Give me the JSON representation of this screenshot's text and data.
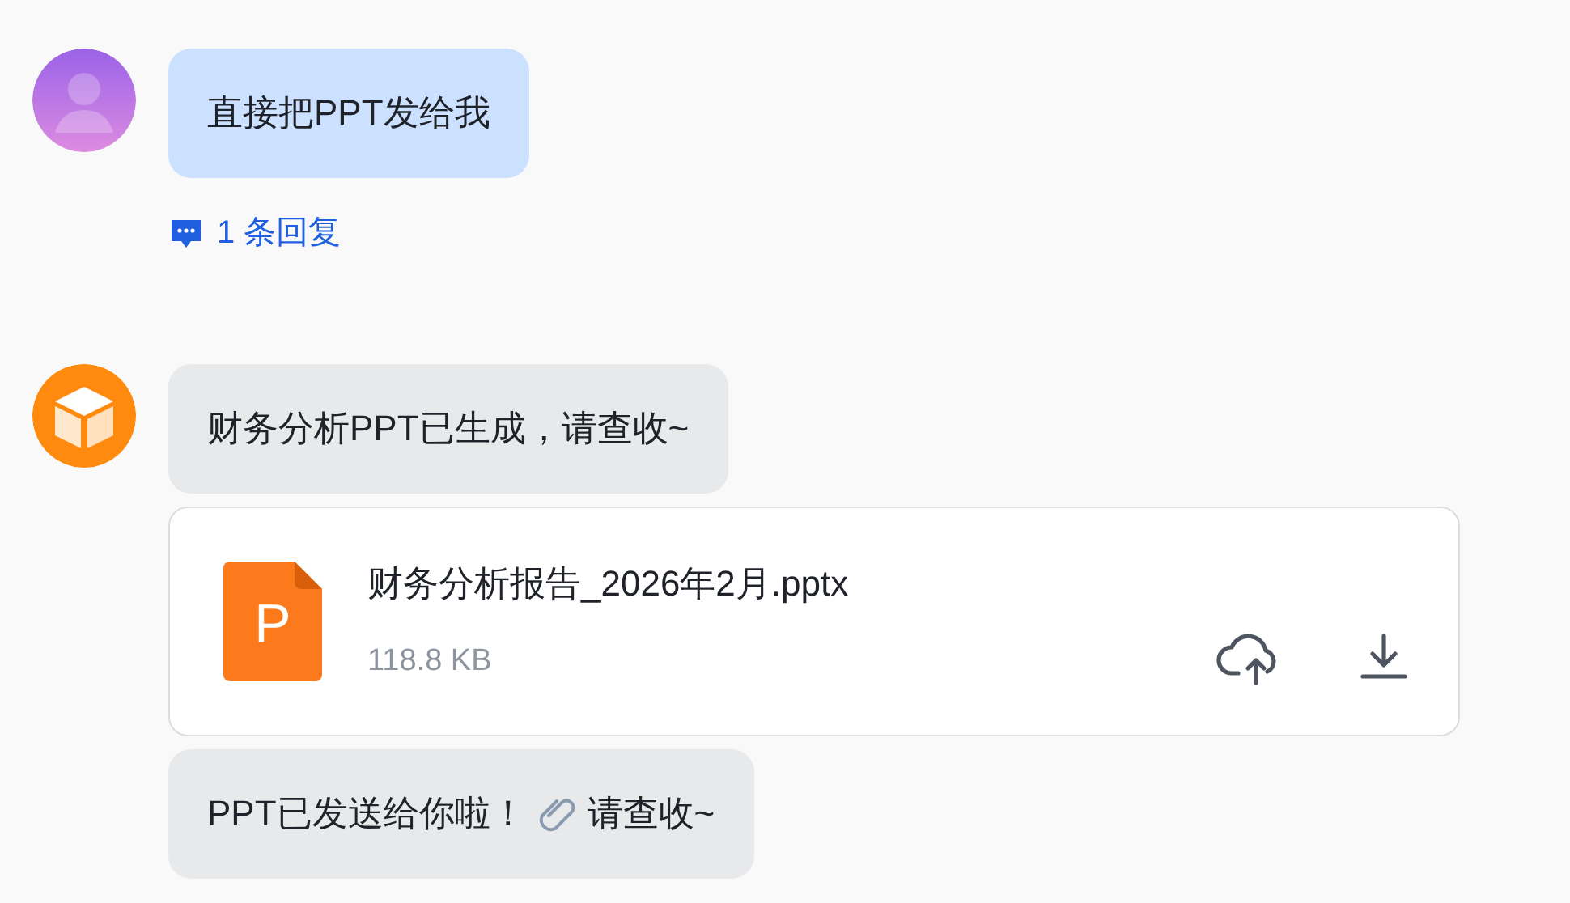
{
  "messages": [
    {
      "kind": "user",
      "text": "直接把PPT发给我",
      "reply_count": "1 条回复"
    },
    {
      "kind": "bot",
      "text": "财务分析PPT已生成，请查收~"
    },
    {
      "kind": "file",
      "icon_letter": "P",
      "name": "财务分析报告_2026年2月.pptx",
      "size": "118.8 KB"
    },
    {
      "kind": "bot_clip",
      "before": "PPT已发送给你啦！",
      "after": "请查收~"
    }
  ]
}
